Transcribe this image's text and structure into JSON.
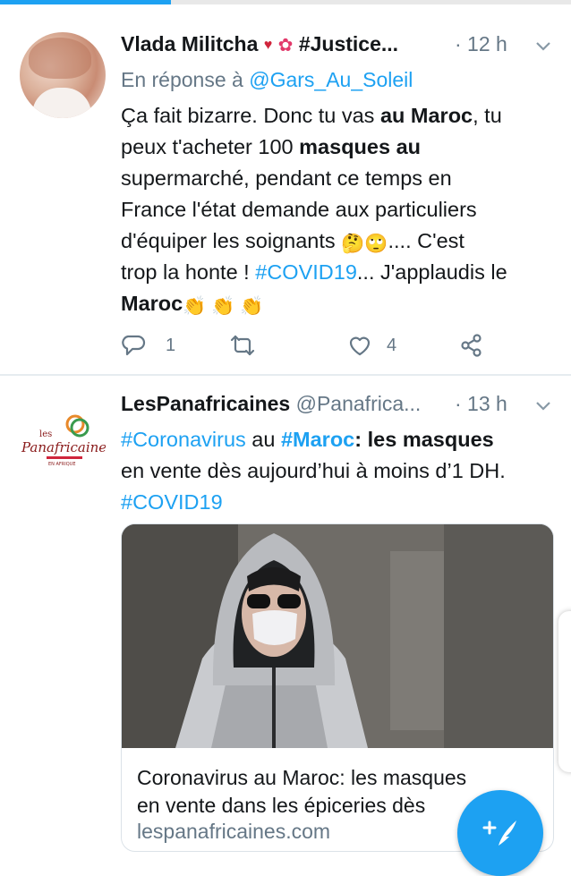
{
  "tweets": [
    {
      "name": "Vlada Militcha",
      "name_suffix": "#Justice...",
      "time": "· 12 h",
      "reply_prefix": "En réponse à",
      "reply_handle": "@Gars_Au_Soleil",
      "body_lines": [
        [
          "Ça fait bizarre. Donc tu vas ",
          "au Maroc",
          ", tu"
        ],
        [
          "peux t'acheter 100 ",
          "masques au"
        ],
        [
          "supermarché, pendant ce temps en"
        ],
        [
          "France l'état demande aux particuliers"
        ],
        [
          "d'équiper les soignants ",
          "🤔🙄",
          ".... C'est"
        ],
        [
          "trop la honte ! ",
          "#COVID19",
          "... J'applaudis le"
        ],
        [
          "Maroc",
          "👏 👏 👏"
        ]
      ],
      "actions": {
        "replies": "1",
        "likes": "4"
      }
    },
    {
      "name": "LesPanafricaines",
      "handle": "@Panafrica...",
      "time": "· 13 h",
      "body_lines": [
        [
          "#Coronavirus",
          " au ",
          "#Maroc",
          ": ",
          "les masques"
        ],
        [
          "en vente dès aujourd’hui à moins d’1 DH."
        ],
        [
          "#COVID19"
        ]
      ],
      "avatar_logo": {
        "line1": "les",
        "line2": "Panafricaines",
        "line3": "EN AFRIQUE"
      },
      "card": {
        "title_lines": [
          "Coronavirus au Maroc: les masques",
          "en vente dans les épiceries dès"
        ],
        "domain": "lespanafricaines.com"
      }
    }
  ],
  "colors": {
    "accent": "#1da1f2",
    "muted": "#657786",
    "heart_marker": "#d0253c"
  },
  "icons": [
    "heart-marker-icon",
    "hibiscus-icon",
    "chevron-down-icon",
    "reply-icon",
    "retweet-icon",
    "like-icon",
    "share-icon",
    "compose-icon"
  ]
}
